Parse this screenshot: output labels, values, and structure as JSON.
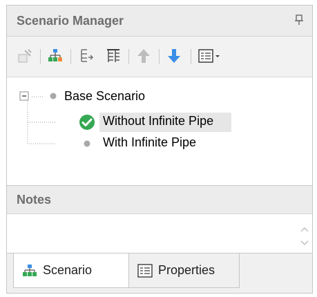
{
  "panel": {
    "title": "Scenario Manager",
    "pin_icon": "pin-icon"
  },
  "toolbar": {
    "buttons": [
      {
        "icon": "new-scenario-icon"
      },
      {
        "icon": "scenario-tree-icon"
      },
      {
        "icon": "tree-indent-icon"
      },
      {
        "icon": "tree-structure-icon"
      },
      {
        "icon": "move-up-arrow-icon"
      },
      {
        "icon": "move-down-arrow-icon"
      },
      {
        "icon": "view-options-dropdown-icon"
      }
    ]
  },
  "tree": {
    "root": {
      "label": "Base Scenario",
      "expanded": true
    },
    "children": [
      {
        "label": "Without Infinite Pipe",
        "current": true,
        "selected": true
      },
      {
        "label": "With Infinite Pipe",
        "current": false,
        "selected": false
      }
    ]
  },
  "notes": {
    "label": "Notes",
    "value": ""
  },
  "tabs": [
    {
      "label": "Scenario",
      "active": true,
      "icon": "scenario-icon"
    },
    {
      "label": "Properties",
      "active": false,
      "icon": "properties-icon"
    }
  ],
  "colors": {
    "check_green": "#35a853",
    "arrow_blue": "#3a8ee6",
    "arrow_gray": "#bdbdbd",
    "header_gray": "#6e6e6e"
  }
}
